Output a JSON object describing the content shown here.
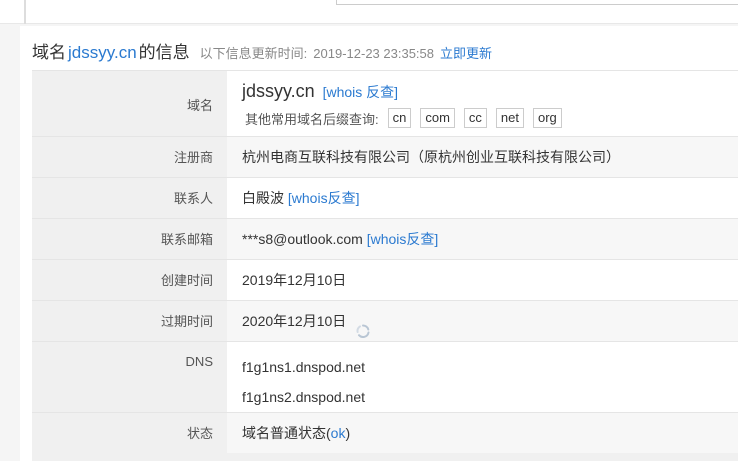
{
  "header": {
    "prefix": "域名",
    "domain": "jdssyy.cn",
    "suffix": "的信息",
    "update_label": "以下信息更新时间:",
    "update_time": "2019-12-23 23:35:58",
    "refresh_link": "立即更新"
  },
  "rows": {
    "domain": {
      "label": "域名",
      "name": "jdssyy.cn",
      "whois": "[whois 反查]",
      "suffix_label": "其他常用域名后缀查询:",
      "suffixes": [
        "cn",
        "com",
        "cc",
        "net",
        "org"
      ]
    },
    "registrar": {
      "label": "注册商",
      "value": "杭州电商互联科技有限公司（原杭州创业互联科技有限公司）"
    },
    "contact": {
      "label": "联系人",
      "value": "白殿波",
      "whois": "[whois反查]"
    },
    "email": {
      "label": "联系邮箱",
      "value": "***s8@outlook.com",
      "whois": "[whois反查]"
    },
    "created": {
      "label": "创建时间",
      "value": "2019年12月10日"
    },
    "expires": {
      "label": "过期时间",
      "value": "2020年12月10日"
    },
    "dns": {
      "label": "DNS",
      "servers": [
        "f1g1ns1.dnspod.net",
        "f1g1ns2.dnspod.net"
      ]
    },
    "status": {
      "label": "状态",
      "prefix": "域名普通状态(",
      "code": "ok",
      "suffix": ")"
    }
  },
  "icons": {
    "refresh": "refresh-icon"
  },
  "colors": {
    "link": "#2b7ad0",
    "label_bg": "#f0f0f0"
  }
}
